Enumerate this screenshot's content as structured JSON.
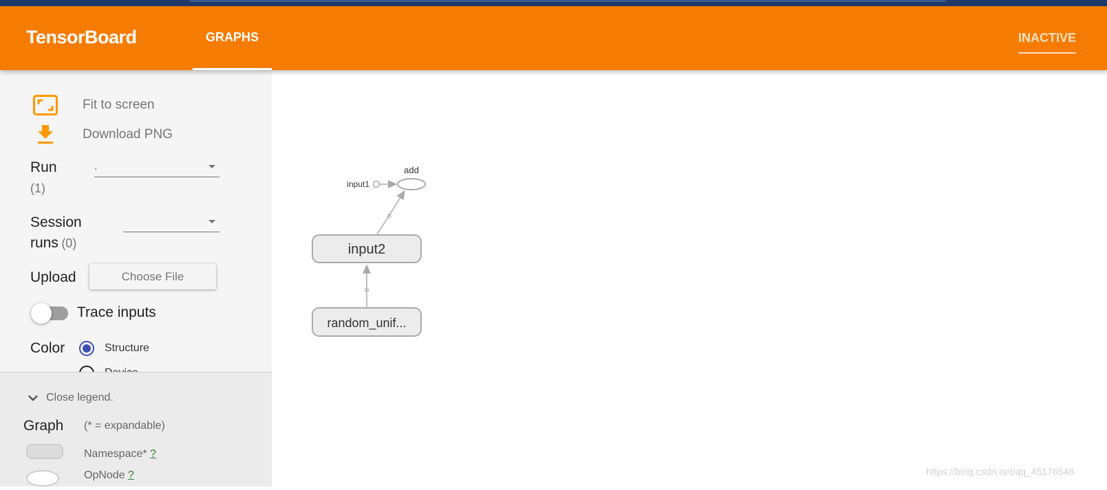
{
  "header": {
    "brand": "TensorBoard",
    "tabs": [
      {
        "label": "GRAPHS",
        "active": true
      },
      {
        "label": "INACTIVE",
        "active": false
      }
    ],
    "color": "#f57c00"
  },
  "sidebar": {
    "fit_label": "Fit to screen",
    "download_label": "Download PNG",
    "run_label": "Run",
    "run_count": "(1)",
    "run_value": ".",
    "session_label": "Session",
    "session_runs": "runs",
    "session_count": "(0)",
    "session_value": "",
    "upload_label": "Upload",
    "choose_file": "Choose File",
    "trace_label": "Trace inputs",
    "trace_enabled": false,
    "color_label": "Color",
    "color_options": [
      "Structure",
      "Device"
    ],
    "color_selected": "Structure"
  },
  "legend": {
    "close": "Close legend.",
    "graph_label": "Graph",
    "expandable": "(* = expandable)",
    "namespace": "Namespace*",
    "opnode": "OpNode",
    "help": "?"
  },
  "graph": {
    "nodes": [
      "add",
      "input1",
      "input2",
      "random_unif..."
    ]
  },
  "watermark": "https://blog.csdn.net/qq_45176548"
}
